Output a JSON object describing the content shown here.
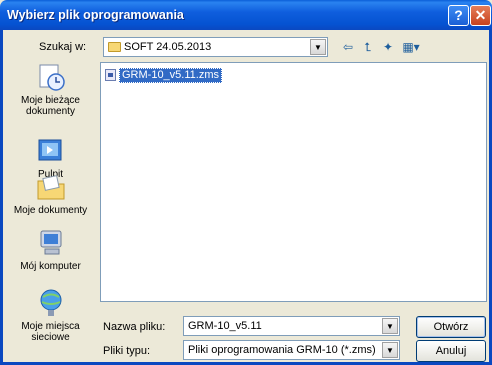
{
  "window": {
    "title": "Wybierz plik oprogramowania",
    "help_glyph": "?",
    "close_glyph": "✕"
  },
  "lookin": {
    "label": "Szukaj w:",
    "value": "SOFT 24.05.2013"
  },
  "toolbar": {
    "back_glyph": "⇦",
    "up_glyph": "⮤",
    "newfolder_glyph": "✦",
    "views_glyph": "▦▾"
  },
  "places": [
    {
      "label": "Moje bieżące dokumenty",
      "icon": "recent-documents-icon"
    },
    {
      "label": "Pulpit",
      "icon": "desktop-icon"
    },
    {
      "label": "Moje dokumenty",
      "icon": "my-documents-icon"
    },
    {
      "label": "Mój komputer",
      "icon": "my-computer-icon"
    },
    {
      "label": "Moje miejsca sieciowe",
      "icon": "network-places-icon"
    }
  ],
  "files": [
    {
      "name": "GRM-10_v5.11.zms",
      "selected": true
    }
  ],
  "filename": {
    "label": "Nazwa pliku:",
    "value": "GRM-10_v5.11"
  },
  "filetype": {
    "label": "Pliki typu:",
    "value": "Pliki oprogramowania GRM-10 (*.zms)"
  },
  "buttons": {
    "open": "Otwórz",
    "cancel": "Anuluj"
  },
  "colors": {
    "titlebar": "#0553D2",
    "selection": "#316AC5",
    "dialog": "#ECE9D8"
  }
}
